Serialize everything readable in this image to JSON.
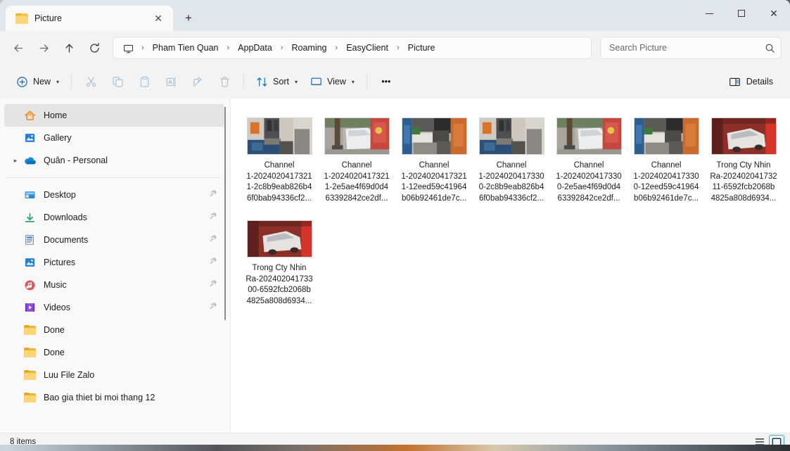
{
  "window": {
    "tab_title": "Picture",
    "tab_close_label": "✕",
    "new_tab_label": "+",
    "minimize_label": "minimize",
    "maximize_label": "maximize",
    "close_label": "✕"
  },
  "navbar": {
    "back_label": "Back",
    "forward_label": "Forward",
    "up_label": "Up",
    "refresh_label": "Refresh",
    "breadcrumbs": [
      {
        "label": "Pham Tien Quan"
      },
      {
        "label": "AppData"
      },
      {
        "label": "Roaming"
      },
      {
        "label": "EasyClient"
      },
      {
        "label": "Picture"
      }
    ],
    "separator": "›",
    "search": {
      "placeholder": "Search Picture",
      "value": ""
    }
  },
  "commandbar": {
    "new_label": "New",
    "cut_label": "Cut",
    "copy_label": "Copy",
    "paste_label": "Paste",
    "rename_label": "Rename",
    "share_label": "Share",
    "delete_label": "Delete",
    "sort_label": "Sort",
    "view_label": "View",
    "more_label": "•••",
    "details_label": "Details",
    "chevron": "⌄"
  },
  "sidebar": {
    "items": [
      {
        "label": "Home",
        "icon": "home-icon",
        "selected": true,
        "expander": false,
        "pinned": false
      },
      {
        "label": "Gallery",
        "icon": "gallery-icon",
        "selected": false,
        "expander": false,
        "pinned": false
      },
      {
        "label": "Quân - Personal",
        "icon": "onedrive-icon",
        "selected": false,
        "expander": true,
        "pinned": false
      }
    ],
    "pinned_items": [
      {
        "label": "Desktop",
        "icon": "desktop-icon",
        "pinned": true
      },
      {
        "label": "Downloads",
        "icon": "downloads-icon",
        "pinned": true
      },
      {
        "label": "Documents",
        "icon": "documents-icon",
        "pinned": true
      },
      {
        "label": "Pictures",
        "icon": "pictures-icon",
        "pinned": true
      },
      {
        "label": "Music",
        "icon": "music-icon",
        "pinned": true
      },
      {
        "label": "Videos",
        "icon": "videos-icon",
        "pinned": true
      },
      {
        "label": "Done",
        "icon": "folder-icon",
        "pinned": false
      },
      {
        "label": "Done",
        "icon": "folder-icon",
        "pinned": false
      },
      {
        "label": "Luu File Zalo",
        "icon": "folder-icon",
        "pinned": false
      },
      {
        "label": "Bao gia thiet bi moi thang 12",
        "icon": "folder-icon",
        "pinned": false
      }
    ]
  },
  "files": [
    {
      "name": "Channel 1-20240204173211-2c8b9eab826b46f0bab94336cf2...",
      "display": "Channel\n1-2024020417321\n1-2c8b9eab826b4\n6f0bab94336cf2...",
      "thumb": "cctv-counter-indoor"
    },
    {
      "name": "Channel 1-20240204173211-2e5ae4f69d0d463392842ce2df...",
      "display": "Channel\n1-2024020417321\n1-2e5ae4f69d0d4\n63392842ce2df...",
      "thumb": "cctv-street-car"
    },
    {
      "name": "Channel 1-20240204173211-12eed59c41964b06b92461de7c...",
      "display": "Channel\n1-2024020417321\n1-12eed59c41964\nb06b92461de7c...",
      "thumb": "cctv-shop-aisle"
    },
    {
      "name": "Channel 1-20240204173300-2c8b9eab826b46f0bab94336cf2...",
      "display": "Channel\n1-2024020417330\n0-2c8b9eab826b4\n6f0bab94336cf2...",
      "thumb": "cctv-counter-indoor"
    },
    {
      "name": "Channel 1-20240204173300-2e5ae4f69d0d463392842ce2df...",
      "display": "Channel\n1-2024020417330\n0-2e5ae4f69d0d4\n63392842ce2df...",
      "thumb": "cctv-street-car"
    },
    {
      "name": "Channel 1-20240204173300-12eed59c41964b06b92461de7c...",
      "display": "Channel\n1-2024020417330\n0-12eed59c41964\nb06b92461de7c...",
      "thumb": "cctv-shop-aisle"
    },
    {
      "name": "Trong Cty Nhin Ra-20240204173211-6592fcb2068b4825a808d6934...",
      "display": "Trong Cty Nhin\nRa-202402041732\n11-6592fcb2068b\n4825a808d6934...",
      "thumb": "cctv-red-car"
    },
    {
      "name": "Trong Cty Nhin Ra-20240204173300-6592fcb2068b4825a808d6934...",
      "display": "Trong Cty Nhin\nRa-202402041733\n00-6592fcb2068b\n4825a808d6934...",
      "thumb": "cctv-red-car"
    }
  ],
  "statusbar": {
    "item_count": "8 items",
    "list_view_label": "List view",
    "tiles_view_label": "Large icons view"
  },
  "colors": {
    "accent": "#0078d4",
    "titlebar_bg": "#dfe6ec",
    "chrome_bg": "#f3f3f3",
    "content_bg": "#ffffff",
    "navpane_bg": "#f9f9f9",
    "selected_bg": "#e4e4e4",
    "folder_yellow": "#fbd478",
    "view_toggle_active_border": "#4aa3df"
  }
}
